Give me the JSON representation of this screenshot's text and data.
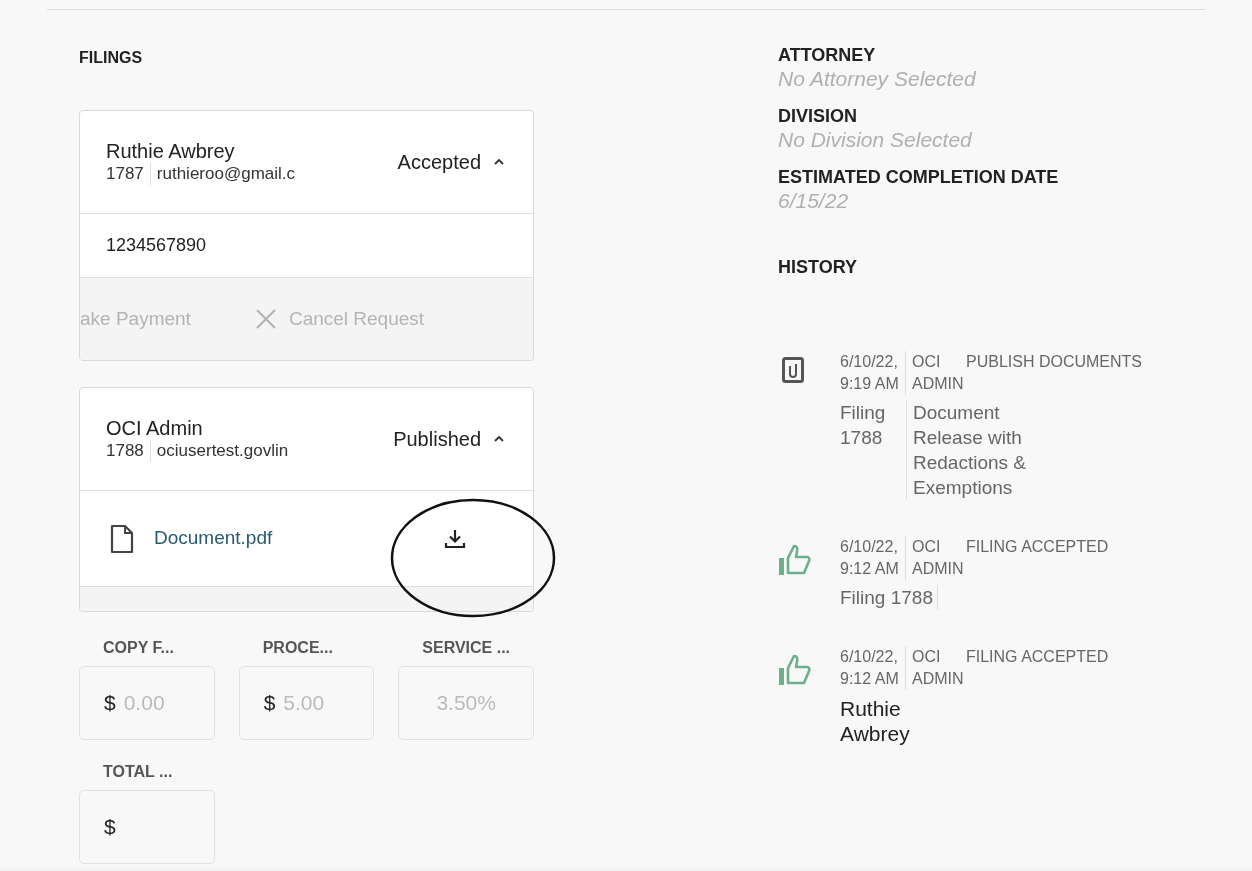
{
  "filings_heading": "FILINGS",
  "filings": [
    {
      "name": "Ruthie Awbrey",
      "id": "1787",
      "email": "ruthieroo@gmail.c",
      "status": "Accepted",
      "expanded": true,
      "body": {
        "kind": "text",
        "text": "1234567890"
      },
      "actions": [
        {
          "kind": "payment",
          "label": "ake Payment"
        },
        {
          "kind": "cancel",
          "label": "Cancel Request"
        }
      ]
    },
    {
      "name": "OCI Admin",
      "id": "1788",
      "email": "ociusertest.govlin",
      "status": "Published",
      "expanded": true,
      "body": {
        "kind": "document",
        "file": "Document.pdf"
      }
    }
  ],
  "fees": [
    {
      "label": "COPY F...",
      "prefix": "$",
      "value": "0.00"
    },
    {
      "label": "PROCE...",
      "prefix": "$",
      "value": "5.00"
    },
    {
      "label": "SERVICE ...",
      "value": "3.50%"
    },
    {
      "label": "TOTAL ...",
      "prefix": "$"
    }
  ],
  "details": [
    {
      "label": "ATTORNEY",
      "value": "No Attorney Selected"
    },
    {
      "label": "DIVISION",
      "value": "No Division Selected"
    },
    {
      "label": "ESTIMATED COMPLETION DATE",
      "value": "6/15/22"
    }
  ],
  "history_heading": "HISTORY",
  "history": [
    {
      "kind": "document",
      "date": "6/10/22, 9:19 AM",
      "actor": "OCI ADMIN",
      "action": "PUBLISH DOCUMENTS",
      "body": {
        "kind": "split",
        "subject": "Filing 1788",
        "detail": "Document Release with Redactions & Exemptions"
      }
    },
    {
      "kind": "accepted",
      "date": "6/10/22, 9:12 AM",
      "actor": "OCI ADMIN",
      "action": "FILING ACCEPTED",
      "body": {
        "kind": "split",
        "subject": "Filing 1788"
      }
    },
    {
      "kind": "accepted",
      "date": "6/10/22, 9:12 AM",
      "actor": "OCI ADMIN",
      "action": "FILING ACCEPTED",
      "body": {
        "kind": "name",
        "text": "Ruthie Awbrey"
      }
    }
  ]
}
